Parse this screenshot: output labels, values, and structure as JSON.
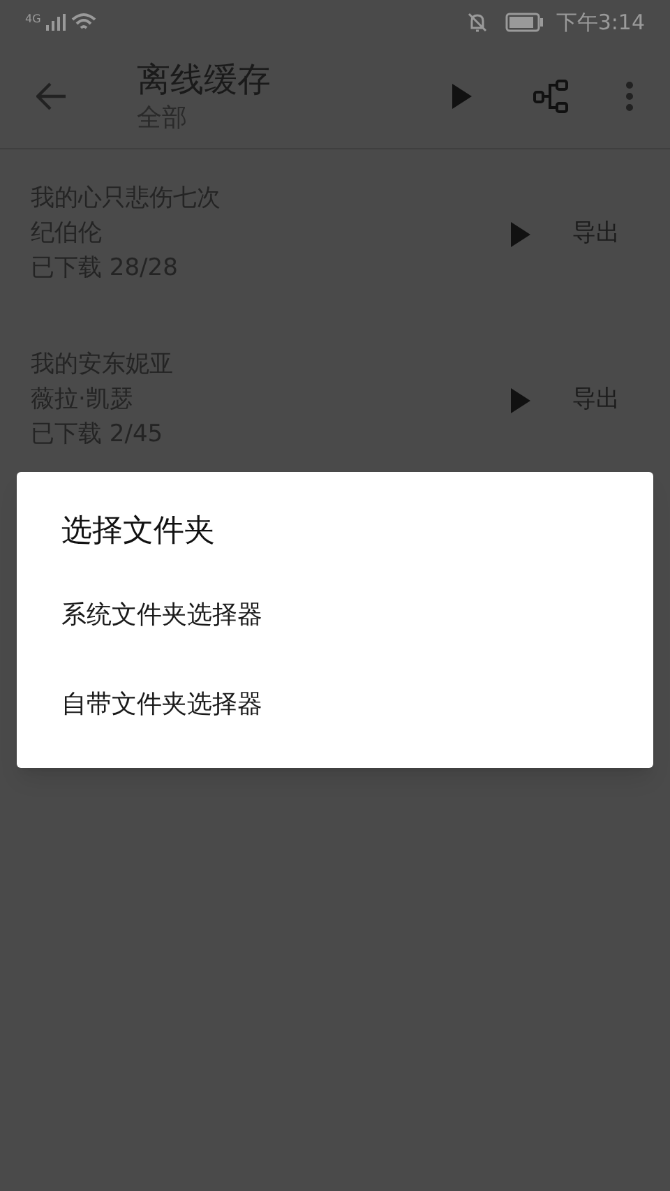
{
  "status_bar": {
    "network": "4G",
    "time": "下午3:14"
  },
  "toolbar": {
    "title": "离线缓存",
    "subtitle": "全部"
  },
  "items": [
    {
      "title": "我的心只悲伤七次",
      "artist": "纪伯伦",
      "progress": "已下载 28/28",
      "action": "导出"
    },
    {
      "title": "我的安东妮亚",
      "artist": "薇拉·凯瑟",
      "progress": "已下载 2/45",
      "action": "导出"
    }
  ],
  "dialog": {
    "title": "选择文件夹",
    "options": [
      "系统文件夹选择器",
      "自带文件夹选择器"
    ]
  }
}
